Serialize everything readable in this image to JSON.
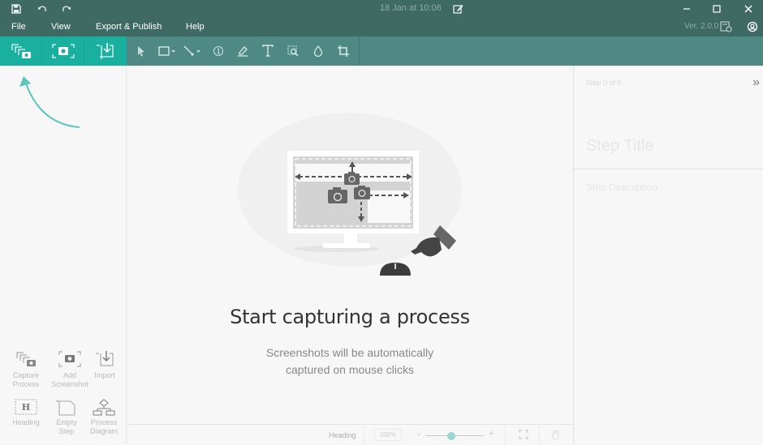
{
  "titlebar": {
    "icons": [
      "save-icon",
      "undo-icon",
      "redo-icon"
    ],
    "date": "18 Jan at 10:06",
    "edit_icon": "edit-title-icon",
    "window_controls": [
      "minimize-icon",
      "maximize-icon",
      "close-icon"
    ]
  },
  "menubar": {
    "items": [
      {
        "label": "File"
      },
      {
        "label": "View"
      },
      {
        "label": "Export & Publish"
      },
      {
        "label": "Help"
      }
    ],
    "version": "Ver. 2.0.0",
    "release_notes_icon": "release-notes-icon",
    "account_icon": "account-icon"
  },
  "toolbar": {
    "capture_buttons": [
      "capture-process-icon",
      "add-screenshot-icon",
      "import-icon"
    ],
    "tools": [
      "pointer-icon",
      "rectangle-icon",
      "line-icon",
      "step-number-icon",
      "highlighter-icon",
      "text-icon",
      "zoom-region-icon",
      "blur-icon",
      "crop-icon"
    ],
    "accent": "#1ab0a0",
    "background": "#4e8a83"
  },
  "left_panel": {
    "items": [
      {
        "label_1": "Capture",
        "label_2": "Process",
        "icon": "capture-process-icon"
      },
      {
        "label_1": "Add",
        "label_2": "Screenshot",
        "icon": "add-screenshot-icon"
      },
      {
        "label_1": "Import",
        "label_2": "",
        "icon": "import-icon"
      },
      {
        "label_1": "Heading",
        "label_2": "",
        "icon": "heading-icon"
      },
      {
        "label_1": "Empty",
        "label_2": "Step",
        "icon": "empty-step-icon"
      },
      {
        "label_1": "Process",
        "label_2": "Diagram",
        "icon": "process-diagram-icon"
      }
    ]
  },
  "main": {
    "title": "Start capturing a process",
    "subtitle_line1": "Screenshots will be automatically",
    "subtitle_line2": "captured on mouse clicks"
  },
  "statusbar": {
    "style": "Heading",
    "zoom": "100%",
    "zoom_minus": "-",
    "zoom_plus": "+",
    "zoom_level": 0.45
  },
  "right_panel": {
    "step_count": "Step 0 of 0",
    "collapse": "»",
    "step_title_placeholder": "Step Title",
    "step_description_placeholder": "Step Description"
  }
}
